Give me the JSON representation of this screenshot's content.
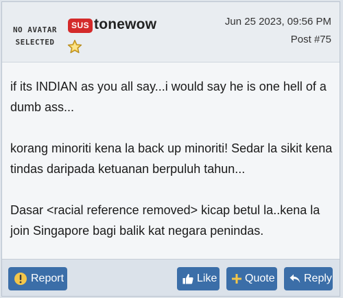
{
  "post": {
    "avatar": {
      "line1": "NO AVATAR",
      "line2": "SELECTED"
    },
    "badge": "SUS",
    "username": "tonewow",
    "rank_icon": "star-icon",
    "date": "Jun 25 2023, 09:56 PM",
    "post_number": "Post #75",
    "body": [
      "if its INDIAN as you all say...i would say he is one hell of a dumb ass...",
      "korang minoriti kena la back up minoriti! Sedar la sikit kena tindas daripada ketuanan berpuluh tahun...",
      "Dasar <racial reference removed> kicap betul la..kena la join Singapore bagi balik kat negara penindas."
    ]
  },
  "actions": {
    "report": {
      "label": "Report",
      "icon": "exclamation-icon"
    },
    "like": {
      "label": "Like",
      "icon": "thumbs-up-icon"
    },
    "quote": {
      "label": "Quote",
      "icon": "plus-icon"
    },
    "reply": {
      "label": "Reply",
      "icon": "reply-arrow-icon"
    }
  },
  "colors": {
    "button": "#3b6ea8",
    "badge": "#d42a2a",
    "star": "#f3c64a"
  }
}
